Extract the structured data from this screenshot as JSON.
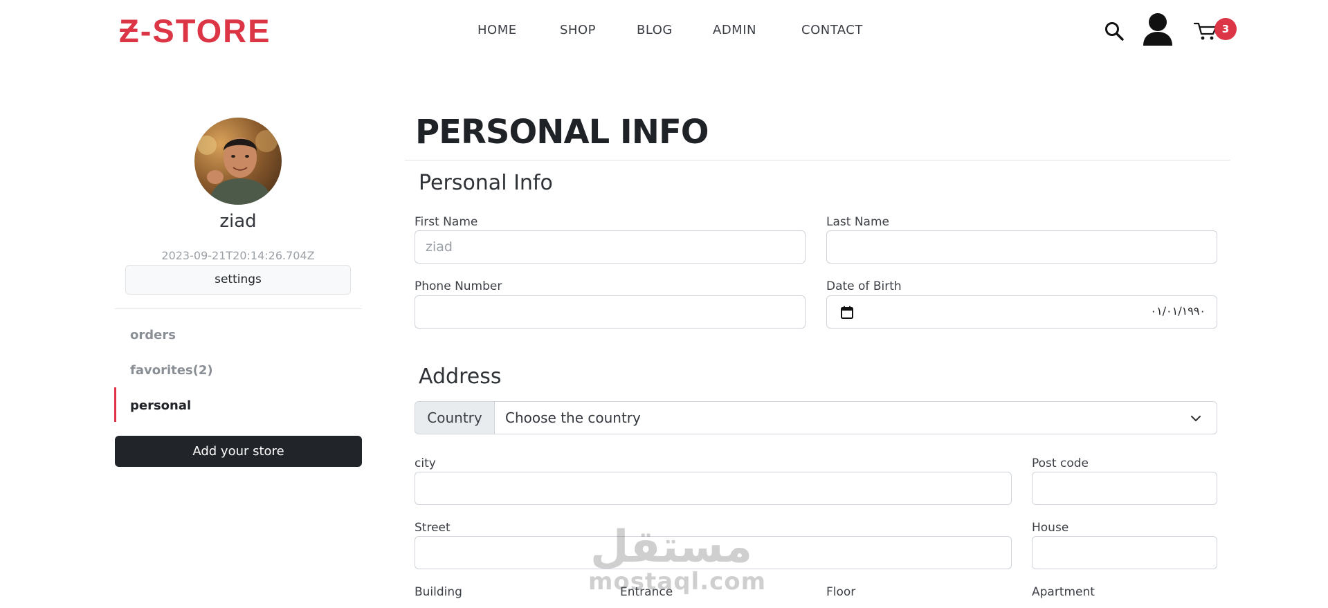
{
  "brand": {
    "logo": "Ƶ-STORE",
    "accent": "#dc3545",
    "dark": "#212529"
  },
  "nav": {
    "items": [
      "HOME",
      "SHOP",
      "BLOG",
      "ADMIN",
      "CONTACT"
    ]
  },
  "header_icons": {
    "search": "search-icon",
    "user": "user-icon",
    "cart": "cart-icon"
  },
  "cart": {
    "count": "3"
  },
  "profile": {
    "name": "ziad",
    "created_at": "2023-09-21T20:14:26.704Z",
    "settings_label": "settings"
  },
  "sidebar": {
    "items": [
      {
        "label": "orders",
        "active": false
      },
      {
        "label": "favorites(2)",
        "active": false
      },
      {
        "label": "personal",
        "active": true
      }
    ],
    "add_store_label": "Add your store"
  },
  "main": {
    "page_title": "PERSONAL INFO",
    "personal_section": "Personal Info",
    "address_section": "Address"
  },
  "personal_fields": {
    "first_name": {
      "label": "First Name",
      "placeholder": "ziad",
      "value": ""
    },
    "last_name": {
      "label": "Last Name",
      "value": ""
    },
    "phone": {
      "label": "Phone Number",
      "value": ""
    },
    "dob": {
      "label": "Date of Birth",
      "value": "٠١/٠١/١٩٩٠"
    }
  },
  "address_fields": {
    "country": {
      "label": "Country",
      "selected": "Choose the country"
    },
    "city": {
      "label": "city",
      "value": ""
    },
    "post_code": {
      "label": "Post code",
      "value": ""
    },
    "street": {
      "label": "Street",
      "value": ""
    },
    "house": {
      "label": "House",
      "value": ""
    },
    "building": {
      "label": "Building"
    },
    "entrance": {
      "label": "Entrance"
    },
    "floor": {
      "label": "Floor"
    },
    "apartment": {
      "label": "Apartment"
    }
  },
  "watermark": {
    "arabic": "مستقل",
    "latin": "mostaql.com"
  }
}
